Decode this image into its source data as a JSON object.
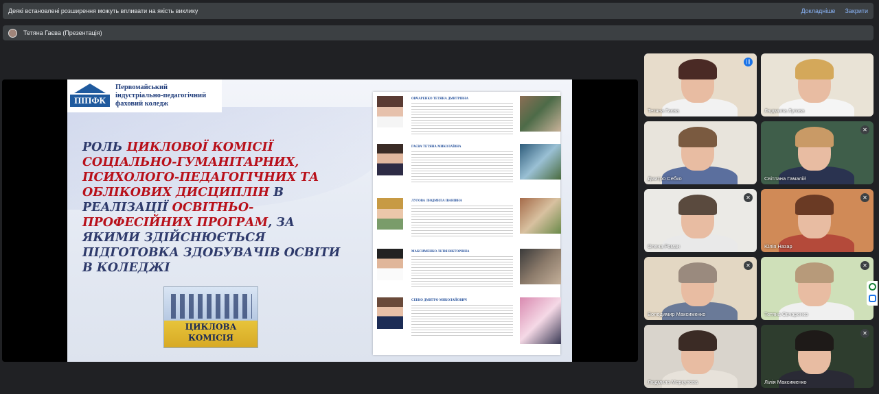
{
  "banner": {
    "message": "Деякі встановлені розширення можуть впливати на якість виклику",
    "details": "Докладніше",
    "close": "Закрити"
  },
  "presenter": {
    "label": "Тетяна Гаєва (Презентація)"
  },
  "slide": {
    "logo_abbr": "ПІПФК",
    "logo_name": [
      "Первомайський",
      "індустріально-педагогічний",
      "фаховий коледж"
    ],
    "title_parts": [
      {
        "text": "Роль ",
        "red": false
      },
      {
        "text": "циклової комісії соціально-гуманітарних, психолого-педагогічних та облікових дисциплін",
        "red": true
      },
      {
        "text": " в реалізації ",
        "red": false
      },
      {
        "text": "освітньо-професійних програм",
        "red": true
      },
      {
        "text": ", за якими здійснюється підготовка здобувачів освіти в коледжі",
        "red": false
      }
    ],
    "image_caption": "Циклова комісія",
    "members": [
      {
        "name": "ОВЧАРЕНКО Тетяна Дмитрівна"
      },
      {
        "name": "ГАЄВА Тетяна Миколаївна"
      },
      {
        "name": "ЛУГОВА Людмила Іванівна"
      },
      {
        "name": "МАКСИМЕНКО Лілія Вікторівна"
      },
      {
        "name": "СЕБКО Дмитро Миколайович"
      }
    ]
  },
  "participants": [
    {
      "name": "Тетяна Гаєва",
      "status": "speaking",
      "active": true,
      "bg": "#e7dccb",
      "hair": "#4a2a25",
      "body": "#f2f2f2"
    },
    {
      "name": "Людмила Лугова",
      "status": "none",
      "active": false,
      "bg": "#e9e3d6",
      "hair": "#d4a85a",
      "body": "#f5f5f5"
    },
    {
      "name": "Дмитро Себко",
      "status": "none",
      "active": false,
      "bg": "#e8e4dc",
      "hair": "#7a5a40",
      "body": "#5b6f9e"
    },
    {
      "name": "Світлана Гамалій",
      "status": "muted",
      "active": false,
      "bg": "#3f5e4a",
      "hair": "#c99a66",
      "body": "#2a3350"
    },
    {
      "name": "Олена Роман",
      "status": "muted",
      "active": false,
      "bg": "#ebeae6",
      "hair": "#5a4a3e",
      "body": "#e9e9e9"
    },
    {
      "name": "Юлія Назар",
      "status": "muted",
      "active": false,
      "bg": "#d08a57",
      "hair": "#6a3a24",
      "body": "#b44a3a"
    },
    {
      "name": "Володимир Максименко",
      "status": "muted",
      "active": false,
      "bg": "#e3d7c3",
      "hair": "#9a8a7e",
      "body": "#6a7a98"
    },
    {
      "name": "Тетяна Овчаренко",
      "status": "muted",
      "active": false,
      "bg": "#cfe0b9",
      "hair": "#b79a7a",
      "body": "#f0f0f0"
    },
    {
      "name": "Людмила Меркулова",
      "status": "none",
      "active": false,
      "bg": "#d9d4cc",
      "hair": "#3b2b25",
      "body": "#e7e2da"
    },
    {
      "name": "Лілія Максименко",
      "status": "muted",
      "active": false,
      "bg": "#2e3d2e",
      "hair": "#1e1a18",
      "body": "#2a2a35"
    }
  ],
  "icons": {
    "mic_off": "✕",
    "speaking": "|||"
  }
}
